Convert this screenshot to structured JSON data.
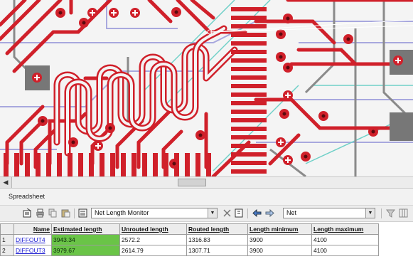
{
  "spreadsheet": {
    "title": "Spreadsheet",
    "monitor_select": "Net Length Monitor",
    "filter_select": "Net",
    "columns": [
      "Name",
      "Estimated length",
      "Unrouted length",
      "Routed length",
      "Length minimum",
      "Length maximum"
    ],
    "rows": [
      {
        "num": "1",
        "name": "DIFFOUT4",
        "estimated": "3943.34",
        "unrouted": "2572.2",
        "routed": "1316.83",
        "min": "3900",
        "max": "4100"
      },
      {
        "num": "2",
        "name": "DIFFOUT3",
        "estimated": "3979.67",
        "unrouted": "2614.79",
        "routed": "1307.71",
        "min": "3900",
        "max": "4100"
      }
    ]
  },
  "colors": {
    "board_bg": "#f4f4f4",
    "trace_red": "#d0202a",
    "trace_gray": "#8a8a8a",
    "trace_purple": "#a8a8de",
    "trace_teal": "#6fd0c8",
    "highlight_green": "#6ac447"
  },
  "icons": [
    "properties-icon",
    "print-icon",
    "copy-icon",
    "paste-icon",
    "monitor-icon",
    "delete-icon",
    "export-icon",
    "back-arrow-icon",
    "forward-arrow-icon",
    "filter-icon",
    "columns-icon"
  ]
}
